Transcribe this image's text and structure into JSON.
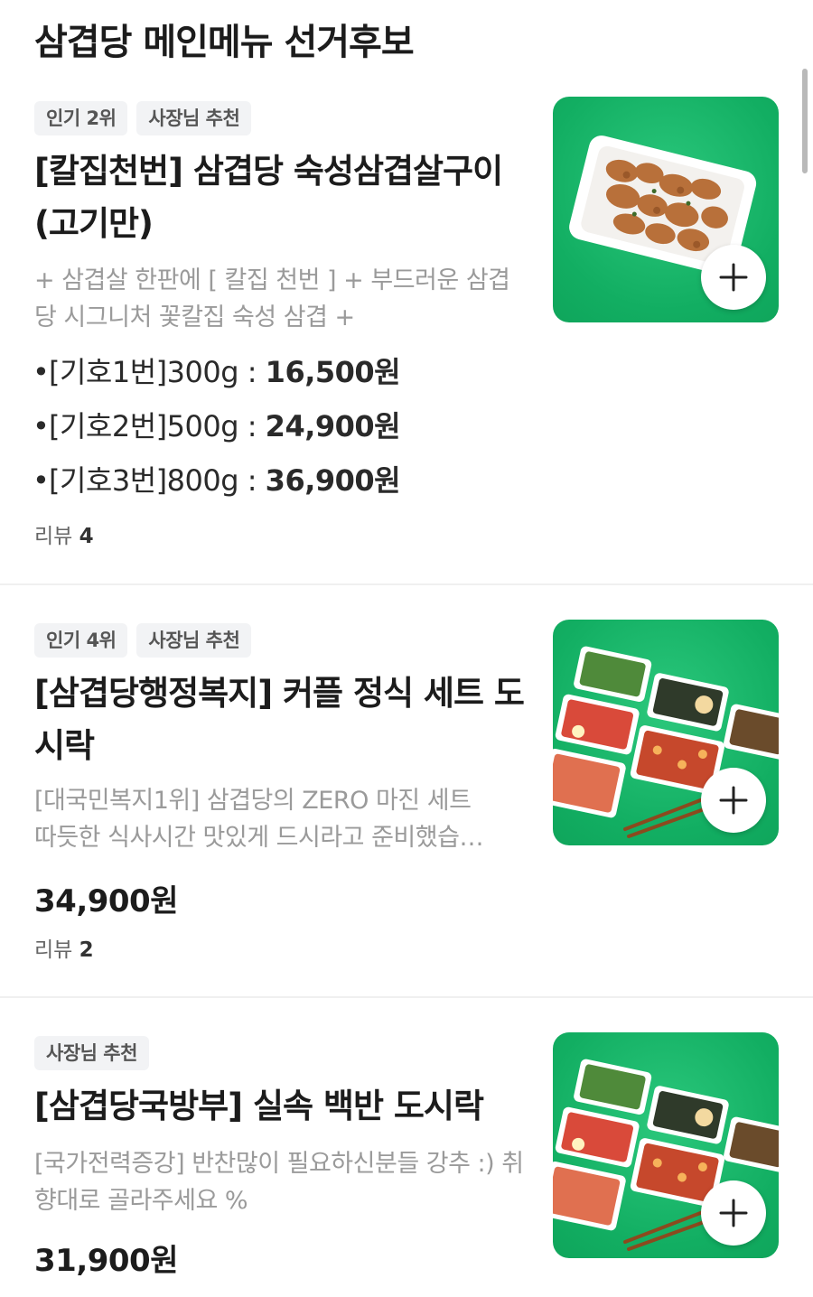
{
  "section": {
    "title": "삼겹당 메인메뉴 선거후보"
  },
  "items": [
    {
      "badges": [
        "인기 2위",
        "사장님 추천"
      ],
      "name": "[칼집천번] 삼겹당 숙성삼겹살구이 (고기만)",
      "description": "+ 삼겹살 한판에 [ 칼집 천번 ] + 부드러운 삼겹당 시그니처 꽃칼집 숙성 삼겹 +",
      "options": [
        {
          "label": "[기호1번]300g : ",
          "price": "16,500원"
        },
        {
          "label": "[기호2번]500g : ",
          "price": "24,900원"
        },
        {
          "label": "[기호3번]800g : ",
          "price": "36,900원"
        }
      ],
      "review_label": "리뷰",
      "review_count": "4"
    },
    {
      "badges": [
        "인기 4위",
        "사장님 추천"
      ],
      "name": "[삼겹당행정복지] 커플 정식 세트 도시락",
      "description_line1": "[대국민복지1위] 삼겹당의 ZERO 마진 세트",
      "description_line2": "따듯한 식사시간 맛있게 드시라고 준비했습…",
      "price": "34,900원",
      "review_label": "리뷰",
      "review_count": "2"
    },
    {
      "badges": [
        "사장님 추천"
      ],
      "name": "[삼겹당국방부] 실속 백반 도시락",
      "description": "[국가전력증강] 반찬많이 필요하신분들 강추 :) 취향대로 골라주세요 %",
      "price": "31,900원"
    }
  ],
  "icons": {
    "add": "plus-icon",
    "bullet": "bullet-icon"
  },
  "colors": {
    "thumb_green": "#12ae62",
    "badge_bg": "#f2f3f5"
  }
}
